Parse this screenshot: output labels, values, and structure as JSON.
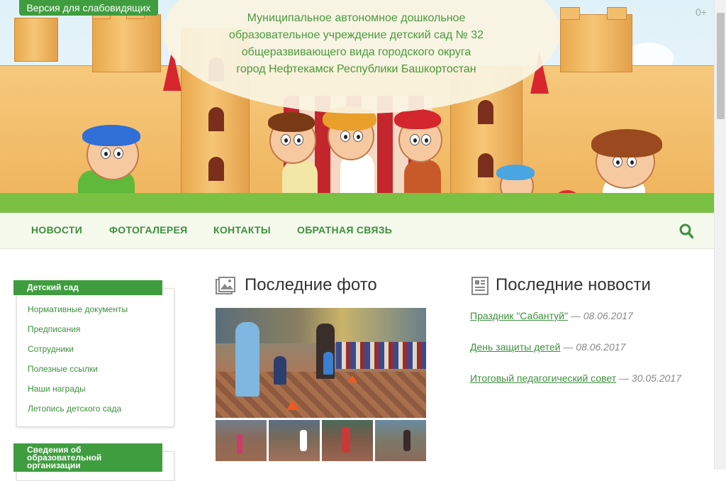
{
  "header": {
    "vision_button": "Версия для слабовидящих",
    "age_rating": "0+",
    "title_lines": [
      "Муниципальное автономное дошкольное",
      "образовательное учреждение детский сад № 32",
      "общеразвивающего вида городского округа",
      "город Нефтекамск Республики Башкортостан"
    ]
  },
  "nav": {
    "items": [
      "НОВОСТИ",
      "ФОТОГАЛЕРЕЯ",
      "КОНТАКТЫ",
      "ОБРАТНАЯ СВЯЗЬ"
    ],
    "search_icon": "search-icon"
  },
  "sidebar": {
    "panels": [
      {
        "title": "Детский сад",
        "links": [
          "Нормативные документы",
          "Предписания",
          "Сотрудники",
          "Полезные ссылки",
          "Наши награды",
          "Летопись детского сада"
        ]
      },
      {
        "title": "Сведения об образовательной организации",
        "links": []
      }
    ]
  },
  "photos": {
    "title": "Последние фото",
    "icon": "image-icon"
  },
  "news": {
    "title": "Последние новости",
    "icon": "newspaper-icon",
    "items": [
      {
        "title": "Праздник \"Сабантуй\"",
        "date": "— 08.06.2017"
      },
      {
        "title": "День защиты детей",
        "date": "— 08.06.2017"
      },
      {
        "title": "Итоговый педагогический совет",
        "date": "— 30.05.2017"
      }
    ]
  },
  "colors": {
    "accent": "#3f9d3f",
    "link": "#3f8f3f",
    "tent": "#c3262d"
  }
}
